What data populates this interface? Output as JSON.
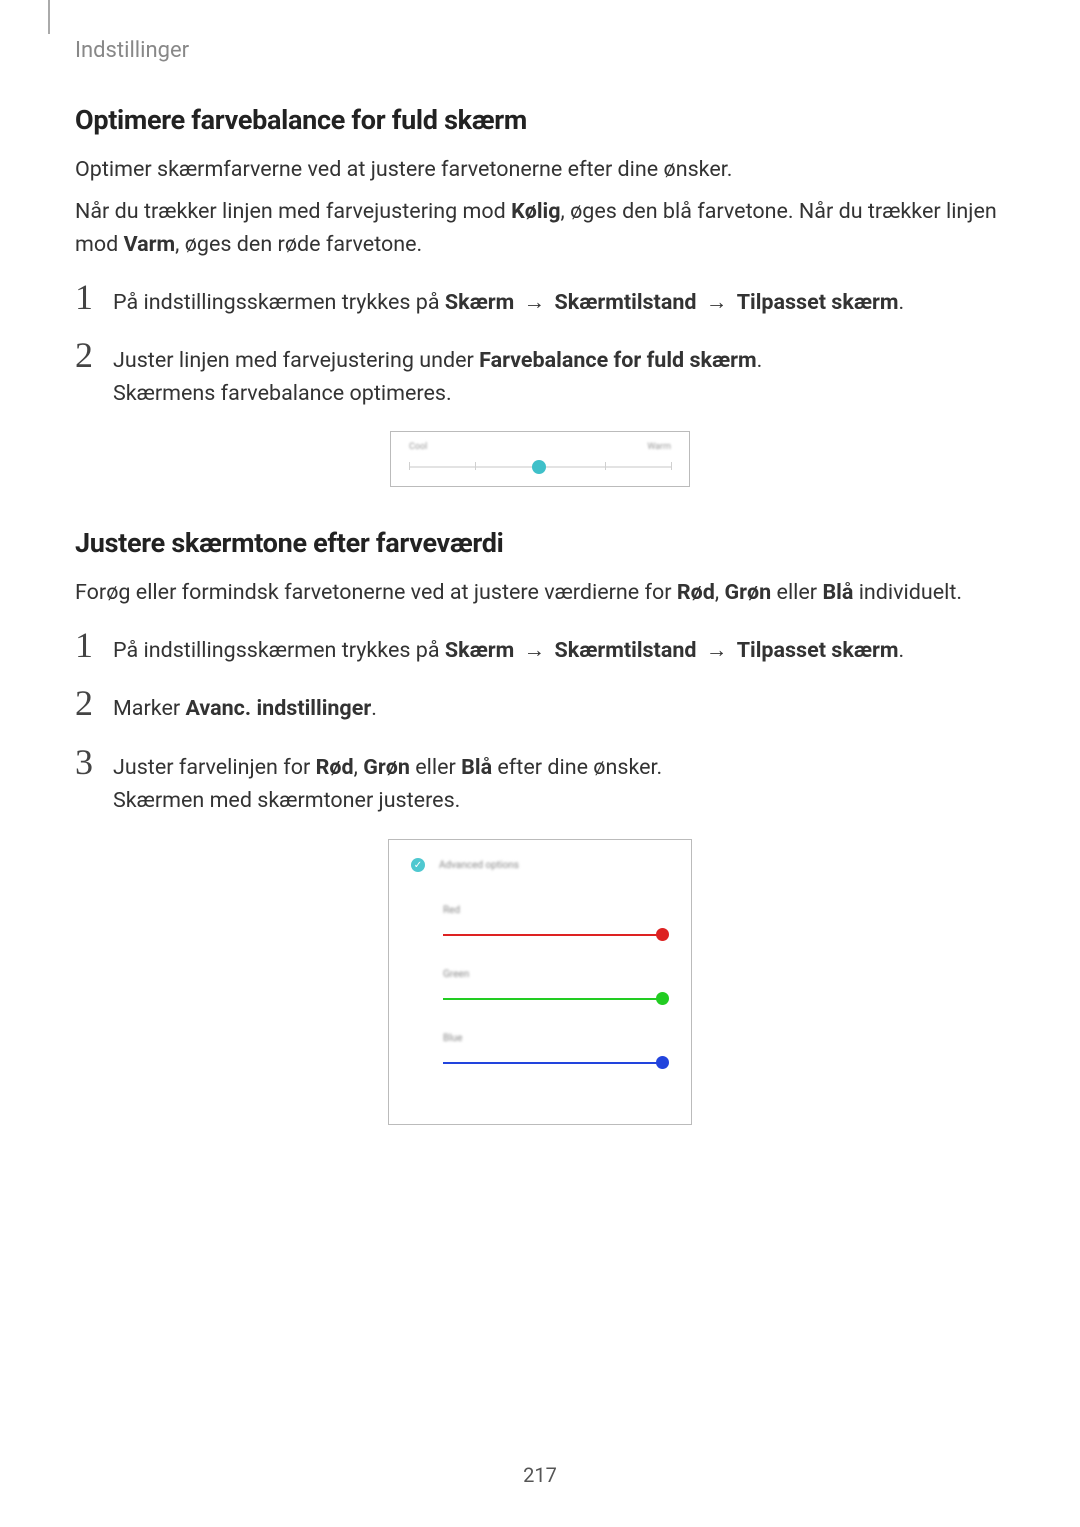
{
  "header": {
    "label": "Indstillinger"
  },
  "section1": {
    "title": "Optimere farvebalance for fuld skærm",
    "p1": "Optimer skærmfarverne ved at justere farvetonerne efter dine ønsker.",
    "p2_pre": "Når du trækker linjen med farvejustering mod ",
    "p2_bold1": "Kølig",
    "p2_mid": ", øges den blå farvetone. Når du trækker linjen mod ",
    "p2_bold2": "Varm",
    "p2_post": ", øges den røde farvetone.",
    "step1": {
      "num": "1",
      "pre": "På indstillingsskærmen trykkes på ",
      "path1": "Skærm",
      "arrow1": "→",
      "path2": "Skærmtilstand",
      "arrow2": "→",
      "path3": "Tilpasset skærm",
      "post": "."
    },
    "step2": {
      "num": "2",
      "pre": "Juster linjen med farvejustering under ",
      "bold": "Farvebalance for fuld skærm",
      "post": ".",
      "line2": "Skærmens farvebalance optimeres."
    },
    "slider": {
      "left": "Cool",
      "right": "Warm"
    }
  },
  "section2": {
    "title": "Justere skærmtone efter farveværdi",
    "p1_pre": "Forøg eller formindsk farvetonerne ved at justere værdierne for ",
    "p1_b1": "Rød",
    "p1_c1": ", ",
    "p1_b2": "Grøn",
    "p1_c2": " eller ",
    "p1_b3": "Blå",
    "p1_post": " individuelt.",
    "step1": {
      "num": "1",
      "pre": "På indstillingsskærmen trykkes på ",
      "path1": "Skærm",
      "arrow1": "→",
      "path2": "Skærmtilstand",
      "arrow2": "→",
      "path3": "Tilpasset skærm",
      "post": "."
    },
    "step2": {
      "num": "2",
      "pre": "Marker ",
      "bold": "Avanc. indstillinger",
      "post": "."
    },
    "step3": {
      "num": "3",
      "pre": "Juster farvelinjen for ",
      "b1": "Rød",
      "c1": ", ",
      "b2": "Grøn",
      "c2": " eller ",
      "b3": "Blå",
      "post": " efter dine ønsker.",
      "line2": "Skærmen med skærmtoner justeres."
    },
    "rgb": {
      "header": "Advanced options",
      "red_label": "Red",
      "green_label": "Green",
      "blue_label": "Blue"
    }
  },
  "pageNumber": "217"
}
